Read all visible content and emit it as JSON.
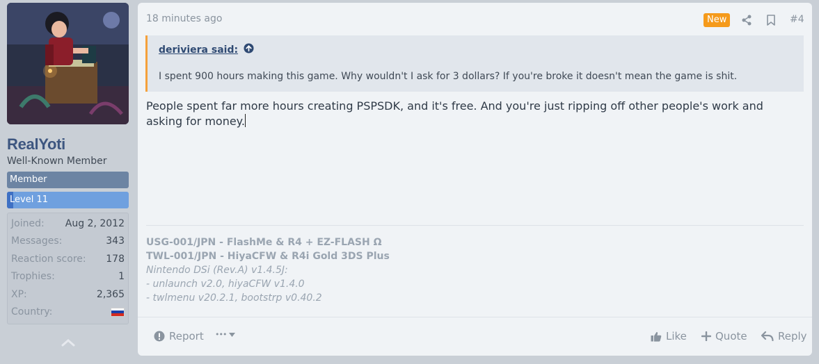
{
  "user": {
    "name": "RealYoti",
    "title": "Well-Known Member",
    "banner_member": "Member",
    "banner_level": "Level 11",
    "level_progress": 0.05,
    "stats": [
      {
        "label": "Joined:",
        "value": "Aug 2, 2012"
      },
      {
        "label": "Messages:",
        "value": "343"
      },
      {
        "label": "Reaction score:",
        "value": "178"
      },
      {
        "label": "Trophies:",
        "value": "1"
      },
      {
        "label": "XP:",
        "value": "2,365"
      },
      {
        "label": "Country:",
        "value": ""
      }
    ],
    "country_flag": [
      "#ffffff",
      "#1c3fa8",
      "#d52b1e"
    ]
  },
  "post": {
    "time": "18 minutes ago",
    "new_badge": "New",
    "number": "#4",
    "quote": {
      "author": "deriviera said:",
      "text": "I spent 900 hours making this game. Why wouldn't I ask for 3 dollars? If you're broke it doesn't mean the game is shit."
    },
    "message": "People spent far more hours creating PSPSDK, and it's free. And you're just ripping off other people's work and asking for money.",
    "signature": {
      "line1": "USG-001/JPN - FlashMe & R4 + EZ-FLASH Ω",
      "line2": "TWL-001/JPN - HiyaCFW & R4i Gold 3DS Plus",
      "line3": "Nintendo DSi (Rev.A) v1.4.5J:",
      "line4": "- unlaunch v2.0, hiyaCFW v1.4.0",
      "line5": "- twlmenu v20.2.1, bootstrp v0.40.2"
    },
    "actions": {
      "report": "Report",
      "more": "•••",
      "like": "Like",
      "quote": "Quote",
      "reply": "Reply"
    }
  },
  "colors": {
    "accent_orange": "#f59a1b",
    "username_blue": "#3d5680",
    "member_banner": "#6c84a3",
    "level_banner": "#6fa0df"
  },
  "icons": [
    "share-icon",
    "bookmark-icon",
    "arrow-up-circle-icon",
    "alert-circle-icon",
    "caret-down-icon",
    "thumbs-up-icon",
    "plus-icon",
    "reply-icon",
    "chevron-up-icon"
  ]
}
